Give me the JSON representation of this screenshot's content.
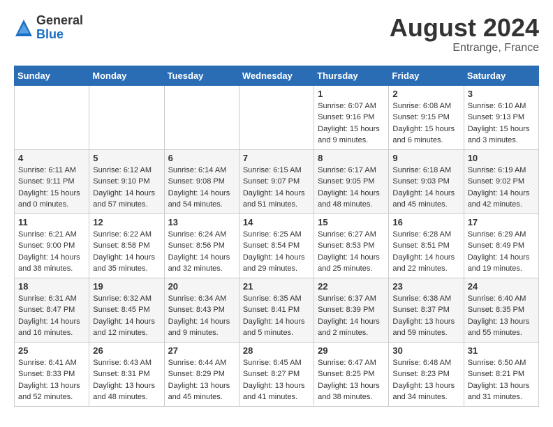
{
  "header": {
    "logo_general": "General",
    "logo_blue": "Blue",
    "month_year": "August 2024",
    "location": "Entrange, France"
  },
  "calendar": {
    "weekdays": [
      "Sunday",
      "Monday",
      "Tuesday",
      "Wednesday",
      "Thursday",
      "Friday",
      "Saturday"
    ],
    "weeks": [
      [
        {
          "day": "",
          "info": ""
        },
        {
          "day": "",
          "info": ""
        },
        {
          "day": "",
          "info": ""
        },
        {
          "day": "",
          "info": ""
        },
        {
          "day": "1",
          "sunrise": "6:07 AM",
          "sunset": "9:16 PM",
          "daylight": "15 hours and 9 minutes."
        },
        {
          "day": "2",
          "sunrise": "6:08 AM",
          "sunset": "9:15 PM",
          "daylight": "15 hours and 6 minutes."
        },
        {
          "day": "3",
          "sunrise": "6:10 AM",
          "sunset": "9:13 PM",
          "daylight": "15 hours and 3 minutes."
        }
      ],
      [
        {
          "day": "4",
          "sunrise": "6:11 AM",
          "sunset": "9:11 PM",
          "daylight": "15 hours and 0 minutes."
        },
        {
          "day": "5",
          "sunrise": "6:12 AM",
          "sunset": "9:10 PM",
          "daylight": "14 hours and 57 minutes."
        },
        {
          "day": "6",
          "sunrise": "6:14 AM",
          "sunset": "9:08 PM",
          "daylight": "14 hours and 54 minutes."
        },
        {
          "day": "7",
          "sunrise": "6:15 AM",
          "sunset": "9:07 PM",
          "daylight": "14 hours and 51 minutes."
        },
        {
          "day": "8",
          "sunrise": "6:17 AM",
          "sunset": "9:05 PM",
          "daylight": "14 hours and 48 minutes."
        },
        {
          "day": "9",
          "sunrise": "6:18 AM",
          "sunset": "9:03 PM",
          "daylight": "14 hours and 45 minutes."
        },
        {
          "day": "10",
          "sunrise": "6:19 AM",
          "sunset": "9:02 PM",
          "daylight": "14 hours and 42 minutes."
        }
      ],
      [
        {
          "day": "11",
          "sunrise": "6:21 AM",
          "sunset": "9:00 PM",
          "daylight": "14 hours and 38 minutes."
        },
        {
          "day": "12",
          "sunrise": "6:22 AM",
          "sunset": "8:58 PM",
          "daylight": "14 hours and 35 minutes."
        },
        {
          "day": "13",
          "sunrise": "6:24 AM",
          "sunset": "8:56 PM",
          "daylight": "14 hours and 32 minutes."
        },
        {
          "day": "14",
          "sunrise": "6:25 AM",
          "sunset": "8:54 PM",
          "daylight": "14 hours and 29 minutes."
        },
        {
          "day": "15",
          "sunrise": "6:27 AM",
          "sunset": "8:53 PM",
          "daylight": "14 hours and 25 minutes."
        },
        {
          "day": "16",
          "sunrise": "6:28 AM",
          "sunset": "8:51 PM",
          "daylight": "14 hours and 22 minutes."
        },
        {
          "day": "17",
          "sunrise": "6:29 AM",
          "sunset": "8:49 PM",
          "daylight": "14 hours and 19 minutes."
        }
      ],
      [
        {
          "day": "18",
          "sunrise": "6:31 AM",
          "sunset": "8:47 PM",
          "daylight": "14 hours and 16 minutes."
        },
        {
          "day": "19",
          "sunrise": "6:32 AM",
          "sunset": "8:45 PM",
          "daylight": "14 hours and 12 minutes."
        },
        {
          "day": "20",
          "sunrise": "6:34 AM",
          "sunset": "8:43 PM",
          "daylight": "14 hours and 9 minutes."
        },
        {
          "day": "21",
          "sunrise": "6:35 AM",
          "sunset": "8:41 PM",
          "daylight": "14 hours and 5 minutes."
        },
        {
          "day": "22",
          "sunrise": "6:37 AM",
          "sunset": "8:39 PM",
          "daylight": "14 hours and 2 minutes."
        },
        {
          "day": "23",
          "sunrise": "6:38 AM",
          "sunset": "8:37 PM",
          "daylight": "13 hours and 59 minutes."
        },
        {
          "day": "24",
          "sunrise": "6:40 AM",
          "sunset": "8:35 PM",
          "daylight": "13 hours and 55 minutes."
        }
      ],
      [
        {
          "day": "25",
          "sunrise": "6:41 AM",
          "sunset": "8:33 PM",
          "daylight": "13 hours and 52 minutes."
        },
        {
          "day": "26",
          "sunrise": "6:43 AM",
          "sunset": "8:31 PM",
          "daylight": "13 hours and 48 minutes."
        },
        {
          "day": "27",
          "sunrise": "6:44 AM",
          "sunset": "8:29 PM",
          "daylight": "13 hours and 45 minutes."
        },
        {
          "day": "28",
          "sunrise": "6:45 AM",
          "sunset": "8:27 PM",
          "daylight": "13 hours and 41 minutes."
        },
        {
          "day": "29",
          "sunrise": "6:47 AM",
          "sunset": "8:25 PM",
          "daylight": "13 hours and 38 minutes."
        },
        {
          "day": "30",
          "sunrise": "6:48 AM",
          "sunset": "8:23 PM",
          "daylight": "13 hours and 34 minutes."
        },
        {
          "day": "31",
          "sunrise": "6:50 AM",
          "sunset": "8:21 PM",
          "daylight": "13 hours and 31 minutes."
        }
      ]
    ]
  }
}
